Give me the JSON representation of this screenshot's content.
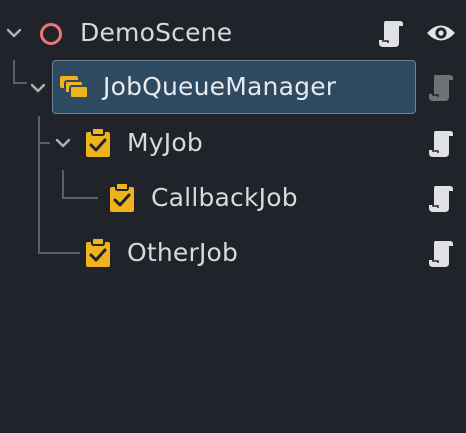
{
  "scene_tree": {
    "nodes": [
      {
        "name": "DemoScene",
        "icon": "node-circle-icon",
        "level": 0,
        "expanded": true,
        "selected": false,
        "has_script": true,
        "visible_toggle": true
      },
      {
        "name": "JobQueueManager",
        "icon": "job-queue-manager-icon",
        "level": 1,
        "expanded": true,
        "selected": true,
        "has_script": true
      },
      {
        "name": "MyJob",
        "icon": "job-clipboard-icon",
        "level": 2,
        "expanded": true,
        "selected": false,
        "has_script": true
      },
      {
        "name": "CallbackJob",
        "icon": "job-clipboard-icon",
        "level": 3,
        "expanded": false,
        "selected": false,
        "has_script": true
      },
      {
        "name": "OtherJob",
        "icon": "job-clipboard-icon",
        "level": 2,
        "expanded": false,
        "selected": false,
        "has_script": true
      }
    ]
  },
  "colors": {
    "background": "#20232a",
    "selection": "#2d4a60",
    "selection_border": "#6f8394",
    "text": "#d6d9de",
    "job_icon": "#efb31c",
    "root_icon": "#f07470",
    "script_icon": "#dfe1e4",
    "guide_line": "#5c5f66"
  }
}
